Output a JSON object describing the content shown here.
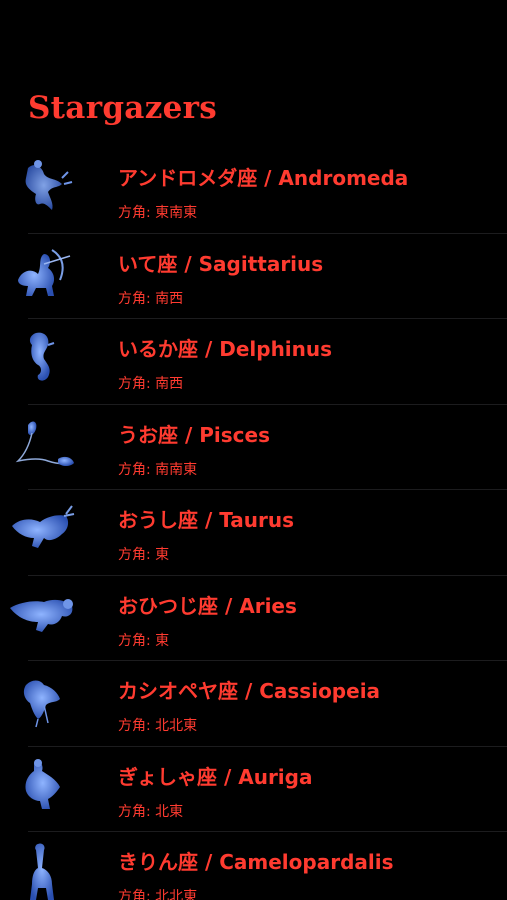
{
  "app": {
    "title": "Stargazers"
  },
  "colors": {
    "background": "#000000",
    "accent": "#ff3b30",
    "divider": "#1c1c1e",
    "illustration": "#3a6fd8"
  },
  "constellations": [
    {
      "name": "アンドロメダ座 / Andromeda",
      "direction": "方角: 東南東",
      "icon": "andromeda-illustration"
    },
    {
      "name": "いて座 / Sagittarius",
      "direction": "方角: 南西",
      "icon": "sagittarius-illustration"
    },
    {
      "name": "いるか座 / Delphinus",
      "direction": "方角: 南西",
      "icon": "delphinus-illustration"
    },
    {
      "name": "うお座 / Pisces",
      "direction": "方角: 南南東",
      "icon": "pisces-illustration"
    },
    {
      "name": "おうし座 / Taurus",
      "direction": "方角: 東",
      "icon": "taurus-illustration"
    },
    {
      "name": "おひつじ座 / Aries",
      "direction": "方角: 東",
      "icon": "aries-illustration"
    },
    {
      "name": "カシオペヤ座 / Cassiopeia",
      "direction": "方角: 北北東",
      "icon": "cassiopeia-illustration"
    },
    {
      "name": "ぎょしゃ座 / Auriga",
      "direction": "方角: 北東",
      "icon": "auriga-illustration"
    },
    {
      "name": "きりん座 / Camelopardalis",
      "direction": "方角: 北北東",
      "icon": "camelopardalis-illustration"
    }
  ]
}
